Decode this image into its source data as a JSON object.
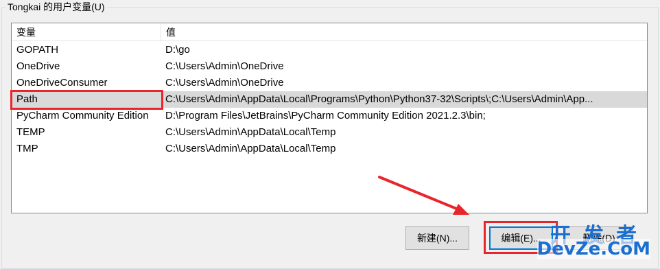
{
  "group": {
    "title": "Tongkai 的用户变量(U)"
  },
  "list": {
    "headers": {
      "variable": "变量",
      "value": "值"
    },
    "rows": [
      {
        "name": "GOPATH",
        "value": "D:\\go"
      },
      {
        "name": "OneDrive",
        "value": "C:\\Users\\Admin\\OneDrive"
      },
      {
        "name": "OneDriveConsumer",
        "value": "C:\\Users\\Admin\\OneDrive"
      },
      {
        "name": "Path",
        "value": "C:\\Users\\Admin\\AppData\\Local\\Programs\\Python\\Python37-32\\Scripts\\;C:\\Users\\Admin\\App..."
      },
      {
        "name": "PyCharm Community Edition",
        "value": "D:\\Program Files\\JetBrains\\PyCharm Community Edition 2021.2.3\\bin;"
      },
      {
        "name": "TEMP",
        "value": "C:\\Users\\Admin\\AppData\\Local\\Temp"
      },
      {
        "name": "TMP",
        "value": "C:\\Users\\Admin\\AppData\\Local\\Temp"
      }
    ],
    "selected_row": "Path"
  },
  "buttons": {
    "new": "新建(N)...",
    "edit": "编辑(E)...",
    "delete": "删除(D)"
  },
  "watermark": {
    "top": "开发者",
    "bottom": "DevZe.CoM"
  },
  "colors": {
    "annotation": "#e8252b",
    "focus": "#0078d7",
    "selection": "#d9d9d9"
  }
}
